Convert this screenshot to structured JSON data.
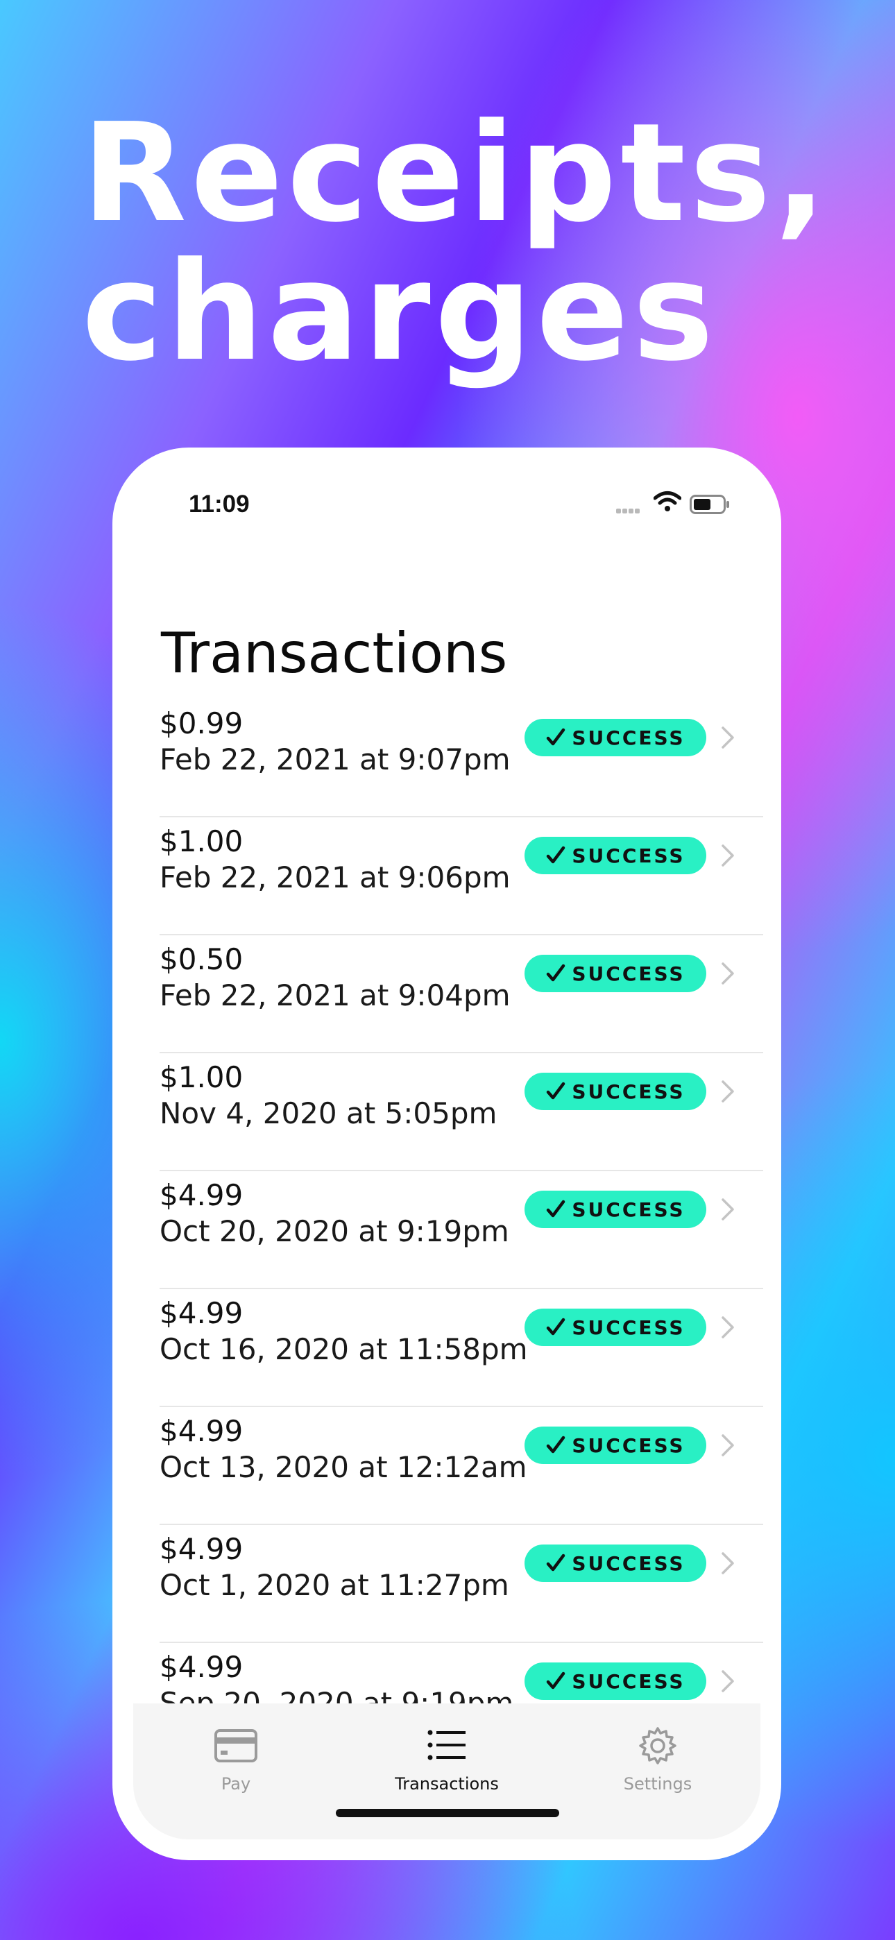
{
  "headline": {
    "line1": "Receipts,",
    "line2": "charges"
  },
  "status_bar": {
    "time": "11:09"
  },
  "page": {
    "title": "Transactions"
  },
  "transactions": [
    {
      "amount": "$0.99",
      "date": "Feb 22, 2021 at 9:07pm",
      "status": "SUCCESS"
    },
    {
      "amount": "$1.00",
      "date": "Feb 22, 2021 at 9:06pm",
      "status": "SUCCESS"
    },
    {
      "amount": "$0.50",
      "date": "Feb 22, 2021 at 9:04pm",
      "status": "SUCCESS"
    },
    {
      "amount": "$1.00",
      "date": "Nov 4, 2020 at 5:05pm",
      "status": "SUCCESS"
    },
    {
      "amount": "$4.99",
      "date": "Oct 20, 2020 at 9:19pm",
      "status": "SUCCESS"
    },
    {
      "amount": "$4.99",
      "date": "Oct 16, 2020 at 11:58pm",
      "status": "SUCCESS"
    },
    {
      "amount": "$4.99",
      "date": "Oct 13, 2020 at 12:12am",
      "status": "SUCCESS"
    },
    {
      "amount": "$4.99",
      "date": "Oct 1, 2020 at 11:27pm",
      "status": "SUCCESS"
    },
    {
      "amount": "$4.99",
      "date": "Sep 20, 2020 at 9:19pm",
      "status": "SUCCESS"
    }
  ],
  "tab_bar": {
    "items": [
      {
        "label": "Pay",
        "icon": "credit-card-icon",
        "active": false
      },
      {
        "label": "Transactions",
        "icon": "list-icon",
        "active": true
      },
      {
        "label": "Settings",
        "icon": "gear-icon",
        "active": false
      }
    ]
  },
  "colors": {
    "badge_background": "#29f0c4",
    "active_tab": "#111111",
    "inactive_tab": "#9a9a9a"
  }
}
